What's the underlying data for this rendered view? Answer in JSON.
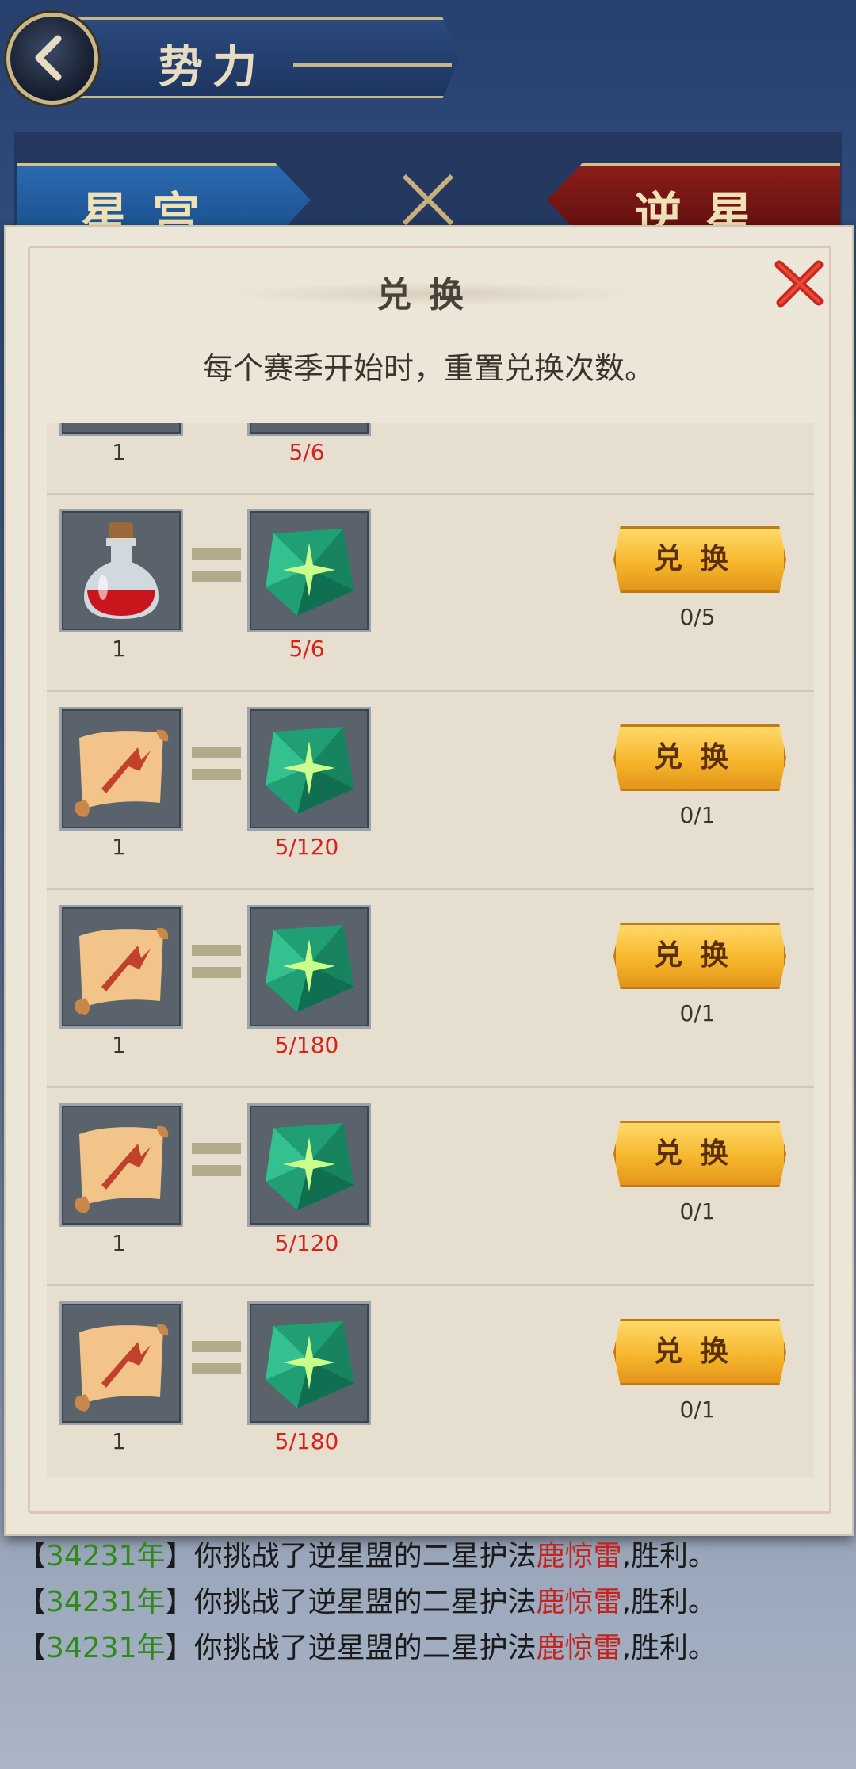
{
  "header": {
    "title": "势力"
  },
  "factions": {
    "left": "星宫",
    "right": "逆星盟"
  },
  "modal": {
    "title": "兑换",
    "subtitle": "每个赛季开始时，重置兑换次数。",
    "rows": [
      {
        "item_icon": "item-icon-partial",
        "cost": "1",
        "reward": "5/6",
        "button": "",
        "limit": ""
      },
      {
        "item_icon": "red-potion-icon",
        "cost": "1",
        "reward": "5/6",
        "button": "兑换",
        "limit": "0/5"
      },
      {
        "item_icon": "scroll-icon",
        "cost": "1",
        "reward": "5/120",
        "button": "兑换",
        "limit": "0/1"
      },
      {
        "item_icon": "scroll-icon",
        "cost": "1",
        "reward": "5/180",
        "button": "兑换",
        "limit": "0/1"
      },
      {
        "item_icon": "scroll-icon",
        "cost": "1",
        "reward": "5/120",
        "button": "兑换",
        "limit": "0/1"
      },
      {
        "item_icon": "scroll-icon",
        "cost": "1",
        "reward": "5/180",
        "button": "兑换",
        "limit": "0/1"
      }
    ],
    "reward_icon": "green-gem-icon"
  },
  "log": [
    {
      "lb": "【",
      "year": "34231年",
      "rb": "】",
      "pre": "你挑战了逆星盟的二星护法",
      "name": "鹿惊雷",
      "post": ",胜利。"
    },
    {
      "lb": "【",
      "year": "34231年",
      "rb": "】",
      "pre": "你挑战了逆星盟的二星护法",
      "name": "鹿惊雷",
      "post": ",胜利。"
    },
    {
      "lb": "【",
      "year": "34231年",
      "rb": "】",
      "pre": "你挑战了逆星盟的二星护法",
      "name": "鹿惊雷",
      "post": ",胜利。"
    }
  ],
  "colors": {
    "accent_gold": "#f6b72c",
    "reward_red": "#d8231b",
    "year_green": "#2f8a1a",
    "name_red": "#c3241d"
  }
}
